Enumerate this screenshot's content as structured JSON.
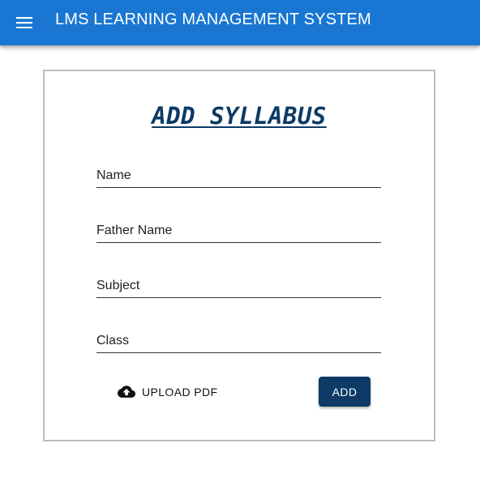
{
  "appbar": {
    "title": "LMS LEARNING MANAGEMENT SYSTEM",
    "menu_icon": "hamburger-menu-icon",
    "background_color": "#1976d2"
  },
  "form": {
    "title": "ADD SYLLABUS",
    "title_color": "#0d3a66",
    "fields": [
      {
        "placeholder": "Name",
        "value": ""
      },
      {
        "placeholder": "Father Name",
        "value": ""
      },
      {
        "placeholder": "Subject",
        "value": ""
      },
      {
        "placeholder": "Class",
        "value": ""
      }
    ],
    "upload_button": {
      "label": "UPLOAD PDF",
      "icon": "cloud-upload-icon"
    },
    "submit_button": {
      "label": "ADD",
      "color": "#0d3a66"
    }
  }
}
